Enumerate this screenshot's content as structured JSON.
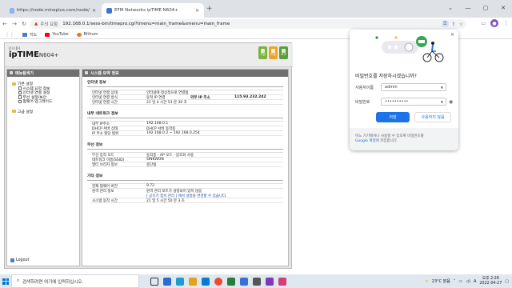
{
  "tabs": [
    {
      "title": "https://node.mineplus.com/node/",
      "active": false
    },
    {
      "title": "EFM Networks ipTIME N604+",
      "active": true
    }
  ],
  "window_controls": [
    "⌄",
    "—",
    "▢",
    "✕"
  ],
  "address": {
    "warning_label": "주의 요함",
    "url": "192.168.0.1/sess-bin/timepro.cgi?tmenu=main_frame&smenu=main_frame"
  },
  "bookmarks": [
    {
      "label": "지도",
      "color": "#4a7fc1"
    },
    {
      "label": "YouTube",
      "color": "#ff0000"
    },
    {
      "label": "Bithum",
      "color": "#f37321"
    }
  ],
  "router": {
    "logo_small": "IIIIDI",
    "logo_brand": "ipTIME",
    "logo_model": "N604+",
    "header_icons": [
      {
        "label": "셋업",
        "color": "#7bb13c"
      },
      {
        "label": "도움",
        "color": "#e8a52c"
      },
      {
        "label": "로고",
        "color": "#5b9e3b"
      }
    ],
    "sidebar": {
      "title": "메뉴탐색기",
      "items": [
        {
          "label": "기본 설정",
          "type": "folder"
        },
        {
          "label": "시스템 요약 정보",
          "type": "doc"
        },
        {
          "label": "인터넷 연결 설정",
          "type": "doc"
        },
        {
          "label": "무선 설정/보안",
          "type": "doc"
        },
        {
          "label": "펌웨어 업그레이드",
          "type": "doc"
        },
        {
          "label": "고급 설정",
          "type": "folder"
        }
      ],
      "logout": "Logout"
    },
    "main_title": "시스템 요약 정보",
    "sections": [
      {
        "title": "인터넷 정보",
        "rows": [
          {
            "k": "인터넷 연결 상태",
            "v": "인터넷에 정상적으로 연결됨"
          },
          {
            "k": "인터넷 연결 방식",
            "v": "동적 IP 연결",
            "k2": "외부 IP 주소",
            "v2": "115.93.232.242"
          },
          {
            "k": "인터넷 연결 시간",
            "v": "21 일 4 시간 53 분 30 초"
          }
        ]
      },
      {
        "title": "내부 네트워크 정보",
        "rows": [
          {
            "k": "내부 IP주소",
            "v": "192.168.0.1"
          },
          {
            "k": "DHCP 서버 상태",
            "v": "DHCP 서버 동작중"
          },
          {
            "k": "IP 주소 할당 범위",
            "v": "192.168.0.2 ~ 192.168.0.254"
          }
        ]
      },
      {
        "title": "무선 정보",
        "rows": [
          {
            "k": "무선 동작 모드",
            "v": "동작중 - AP 모드 - 암호화 사용"
          },
          {
            "k": "네트워크 이름(SSID)",
            "v": "SINKWON"
          },
          {
            "k": "멀티 브리지 정보",
            "v": "중단됨"
          }
        ]
      },
      {
        "title": "기타 정보",
        "rows": [
          {
            "k": "현재 펌웨어 버전",
            "v": "9.72"
          },
          {
            "k": "원격 관리 정보",
            "v": "원격 관리 포트가 설정되어 있지 않음"
          },
          {
            "k": "",
            "v": "[ 공유기 접속 관리 ] 에서 설정을 변경할 수 있습니다.",
            "link": true
          },
          {
            "k": "시스템 동작 시간",
            "v": "21 일 5 시간 50 분 3 초"
          }
        ]
      }
    ]
  },
  "popup": {
    "title": "비밀번호를 저장하시겠습니까?",
    "username_label": "사용자이름",
    "username_value": "admin",
    "password_label": "비밀번호",
    "password_value": "••••••••••",
    "save_label": "저장",
    "never_label": "사용하지 않음",
    "footer_text": "어느 기기에서나 사용할 수 있도록 비밀번호를",
    "footer_link": "Google 계정",
    "footer_text2": "에 저장합니다."
  },
  "taskbar": {
    "search_placeholder": "검색하려면 여기에 입력하십시오.",
    "apps": [
      "#2b6ccf",
      "#1f9bd1",
      "#e3a21a",
      "#0a7bd4",
      "#e94b35",
      "#2a7c3a",
      "#3a6fd8",
      "#555555",
      "#7d3ab8",
      "#d63c7a"
    ],
    "weather": "23°C 맑음",
    "lang": "A",
    "time": "오후 2:26",
    "date": "2022-04-27"
  }
}
